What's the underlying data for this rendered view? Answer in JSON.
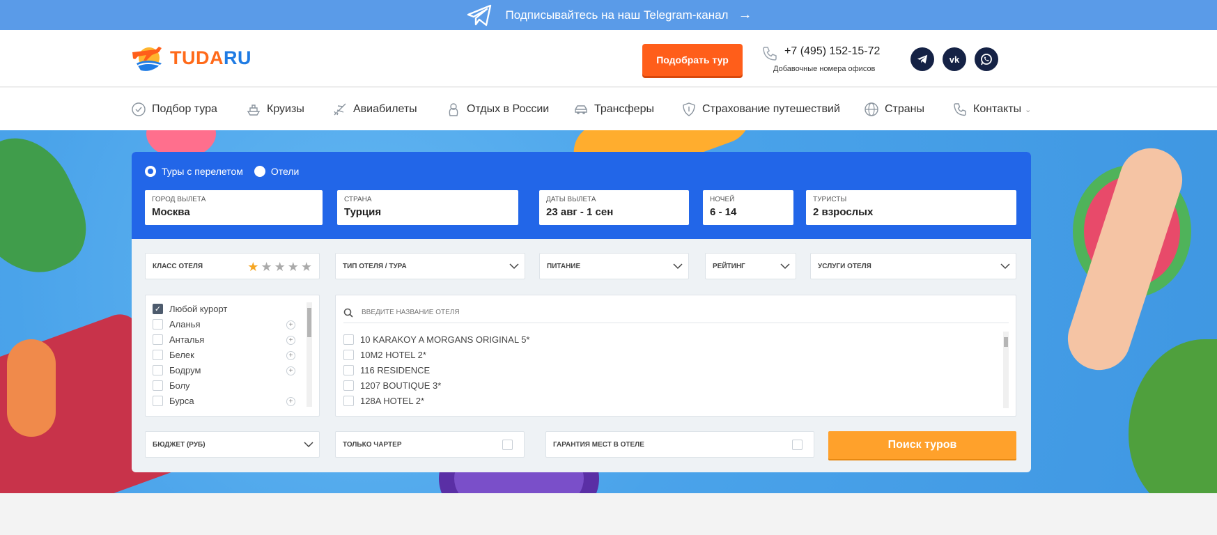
{
  "banner": {
    "text": "Подписывайтесь на наш Telegram-канал",
    "arrow": "→"
  },
  "header": {
    "logo_part1": "TUDA",
    "logo_part2": "RU",
    "pick_button": "Подобрать тур",
    "phone": "+7 (495) 152-15-72",
    "phone_sub": "Добавочные номера офисов",
    "vk_label": "vk"
  },
  "nav": {
    "items": [
      {
        "label": "Подбор тура",
        "icon": "tour-icon"
      },
      {
        "label": "Круизы",
        "icon": "ship-icon"
      },
      {
        "label": "Авиабилеты",
        "icon": "plane-icon"
      },
      {
        "label": "Отдых в России",
        "icon": "matryoshka-icon"
      },
      {
        "label": "Трансферы",
        "icon": "car-icon"
      },
      {
        "label": "Страхование путешествий",
        "icon": "shield-icon"
      },
      {
        "label": "Страны",
        "icon": "globe-icon"
      },
      {
        "label": "Контакты",
        "icon": "phone-icon"
      }
    ]
  },
  "search": {
    "radio_tours": "Туры с перелетом",
    "radio_hotels": "Отели",
    "fields": {
      "city": {
        "label": "Город вылета",
        "value": "Москва"
      },
      "country": {
        "label": "Страна",
        "value": "Турция"
      },
      "dates": {
        "label": "Даты вылета",
        "value": "23 авг - 1 сен"
      },
      "nights": {
        "label": "Ночей",
        "value": "6 - 14"
      },
      "tourists": {
        "label": "Туристы",
        "value": "2 взрослых"
      }
    },
    "filters": {
      "hotel_class": "Класс отеля",
      "hotel_class_stars": 1,
      "hotel_type": "Тип отеля / тура",
      "meal": "Питание",
      "rating": "Рейтинг",
      "services": "Услуги отеля"
    },
    "resorts": [
      {
        "label": "Любой курорт",
        "checked": true,
        "plus": false
      },
      {
        "label": "Аланья",
        "checked": false,
        "plus": true
      },
      {
        "label": "Анталья",
        "checked": false,
        "plus": true
      },
      {
        "label": "Белек",
        "checked": false,
        "plus": true
      },
      {
        "label": "Бодрум",
        "checked": false,
        "plus": true
      },
      {
        "label": "Болу",
        "checked": false,
        "plus": false
      },
      {
        "label": "Бурса",
        "checked": false,
        "plus": true
      }
    ],
    "hotel_placeholder": "Введите название отеля",
    "hotels": [
      "10 KARAKOY A MORGANS ORIGINAL 5*",
      "10M2 HOTEL 2*",
      "116 RESIDENCE",
      "1207 BOUTIQUE 3*",
      "128A HOTEL 2*"
    ],
    "budget": "Бюджет (руб)",
    "charter_only": "Только чартер",
    "hotel_guarantee": "Гарантия мест в отеле",
    "search_button": "Поиск туров"
  },
  "colors": {
    "accent_orange": "#ff5e1a",
    "panel_blue": "#2266e8",
    "search_button": "#ffa12b",
    "banner_blue": "#5a9be8"
  }
}
